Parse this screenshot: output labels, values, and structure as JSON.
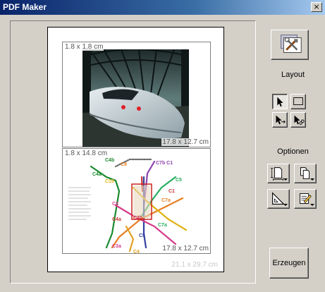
{
  "window": {
    "title": "PDF Maker",
    "close_glyph": "×"
  },
  "page": {
    "size_label": "21.1 x 29.7 cm",
    "slots": [
      {
        "name": "photo-slot",
        "position_label": "1.8 x 1.8 cm",
        "size_label": "17.8 x 12.7 cm",
        "content": "train-photo"
      },
      {
        "name": "map-slot",
        "position_label": "1.8 x 14.8 cm",
        "size_label": "17.8 x 12.7 cm",
        "content": "transit-map"
      }
    ]
  },
  "sidebar": {
    "layout_label": "Layout",
    "options_label": "Optionen",
    "generate_label": "Erzeugen",
    "icons": {
      "settings": "tools-icon",
      "select": "arrow-cursor-icon",
      "rect": "rectangle-icon",
      "move": "move-cursor-icon",
      "cut": "scissors-cursor-icon",
      "page_portrait": "page-portrait-icon",
      "page_copy": "page-duplicate-icon",
      "ruler": "ruler-triangle-icon",
      "edit": "notepad-pencil-icon"
    }
  },
  "colors": {
    "titlebar_start": "#0a246a",
    "titlebar_end": "#a6caf0",
    "face": "#d4d0c8"
  }
}
